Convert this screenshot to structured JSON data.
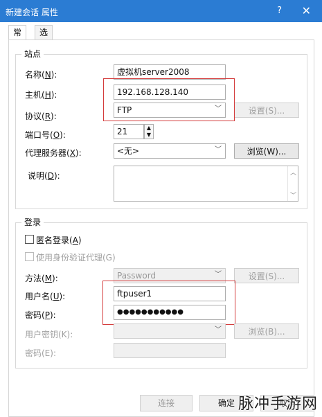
{
  "window": {
    "title": "新建会话 属性",
    "help": "?",
    "close": "✕"
  },
  "tabs": [
    {
      "label": "常规",
      "active": true
    },
    {
      "label": "选项",
      "active": false
    }
  ],
  "site": {
    "legend": "站点",
    "name": {
      "label": "名称(",
      "key": "N",
      "suffix": "):",
      "value": "虚拟机server2008"
    },
    "host": {
      "label": "主机(",
      "key": "H",
      "suffix": "):",
      "value": "192.168.128.140"
    },
    "protocol": {
      "label": "协议(",
      "key": "R",
      "suffix": "):",
      "value": "FTP",
      "settings": "设置(S)..."
    },
    "port": {
      "label": "端口号(",
      "key": "O",
      "suffix": "):",
      "value": "21"
    },
    "proxy": {
      "label": "代理服务器(",
      "key": "X",
      "suffix": "):",
      "value": "<无>",
      "browse": "浏览(W)..."
    },
    "description": {
      "label": "说明(",
      "key": "D",
      "suffix": "):",
      "value": ""
    }
  },
  "login": {
    "legend": "登录",
    "anonymous": {
      "label": "匿名登录(",
      "key": "A",
      "suffix": ")",
      "checked": false
    },
    "use_agent": {
      "label": "使用身份验证代理(G)",
      "checked": false
    },
    "method": {
      "label": "方法(",
      "key": "M",
      "suffix": "):",
      "value": "Password",
      "settings": "设置(S)..."
    },
    "username": {
      "label": "用户名(",
      "key": "U",
      "suffix": "):",
      "value": "ftpuser1"
    },
    "password": {
      "label": "密码(",
      "key": "P",
      "suffix": "):",
      "value": "●●●●●●●●●●●"
    },
    "user_key": {
      "label": "用户密钥(K):",
      "browse": "浏览(B)..."
    },
    "passphrase": {
      "label": "密码(E):"
    }
  },
  "footer": {
    "connect": "连接",
    "ok": "确定",
    "cancel": "取消"
  },
  "watermark": "脉冲手游网",
  "colors": {
    "titlebar": "#2b7cd3",
    "highlight": "#d43c3c"
  }
}
